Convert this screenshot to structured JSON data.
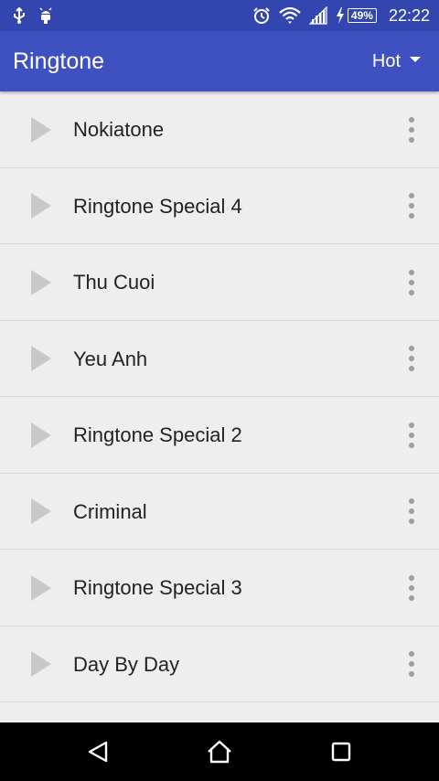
{
  "status_bar": {
    "battery": "49%",
    "time": "22:22",
    "left_icons": [
      "usb-icon",
      "android-debug-icon"
    ],
    "right_icons": [
      "alarm-icon",
      "wifi-icon",
      "signal-icon",
      "charging-icon",
      "battery-icon"
    ]
  },
  "app_bar": {
    "title": "Ringtone",
    "filter_label": "Hot",
    "filter_icon": "dropdown-arrow-icon",
    "color": "#3f51c0",
    "status_color": "#3346b0"
  },
  "list": {
    "play_icon": "play-icon",
    "menu_icon": "more-vert-icon",
    "items": [
      {
        "title": "Nokiatone"
      },
      {
        "title": "Ringtone Special 4"
      },
      {
        "title": "Thu Cuoi"
      },
      {
        "title": "Yeu Anh"
      },
      {
        "title": "Ringtone Special 2"
      },
      {
        "title": "Criminal"
      },
      {
        "title": "Ringtone Special 3"
      },
      {
        "title": "Day By Day"
      }
    ]
  },
  "nav_bar": {
    "buttons": [
      "back-icon",
      "home-icon",
      "recents-icon"
    ]
  }
}
